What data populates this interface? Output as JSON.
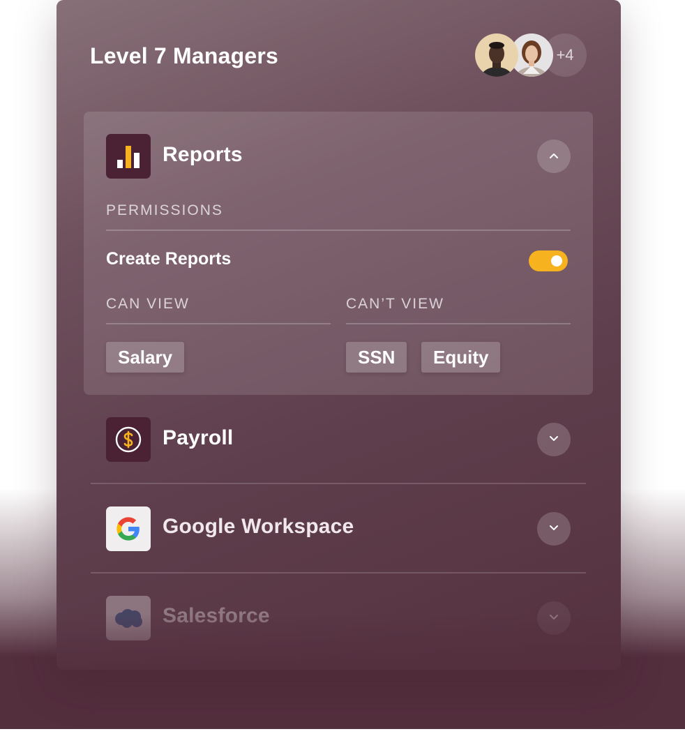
{
  "group": {
    "title": "Level 7 Managers",
    "more_members": "+4"
  },
  "apps": [
    {
      "name": "Reports",
      "icon": "bar-chart-icon",
      "expanded": true,
      "permissions_label": "PERMISSIONS",
      "permission": {
        "label": "Create Reports",
        "enabled": true
      },
      "can_view_label": "CAN VIEW",
      "cant_view_label": "CAN’T VIEW",
      "can_view": [
        "Salary"
      ],
      "cant_view": [
        "SSN",
        "Equity"
      ]
    },
    {
      "name": "Payroll",
      "icon": "dollar-icon",
      "expanded": false
    },
    {
      "name": "Google Workspace",
      "icon": "google-icon",
      "expanded": false
    },
    {
      "name": "Salesforce",
      "icon": "salesforce-icon",
      "expanded": false
    }
  ],
  "colors": {
    "accent": "#f6b21f",
    "panel": "#5f3f4d",
    "icon_bg": "#4a2233"
  }
}
